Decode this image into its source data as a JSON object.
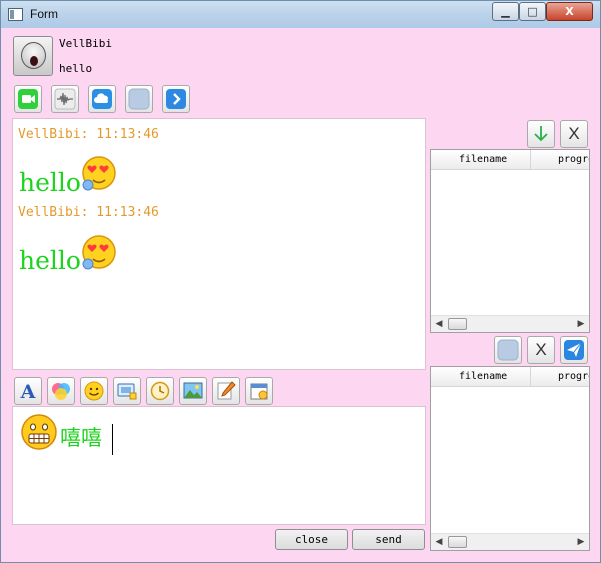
{
  "window": {
    "title": "Form",
    "controls": {
      "minimize": "▁",
      "maximize": "□",
      "close": "X"
    }
  },
  "header": {
    "username": "VellBibi",
    "signature": "hello",
    "toolbar_icons": [
      "video-call-icon",
      "audio-wave-icon",
      "cloud-icon",
      "blank-icon",
      "arrow-right-icon"
    ]
  },
  "messages": [
    {
      "sender": "VellBibi",
      "time": "11:13:46",
      "header_text": "VellBibi:  11:13:46",
      "text": "hello",
      "emoji": "heart-eyes-emoji"
    },
    {
      "sender": "VellBibi",
      "time": "11:13:46",
      "header_text": "VellBibi:  11:13:46",
      "text": "hello",
      "emoji": "heart-eyes-emoji"
    }
  ],
  "input_toolbar": {
    "icons": [
      "font-icon",
      "color-icon",
      "smiley-icon",
      "screenshot-icon",
      "clock-icon",
      "picture-icon",
      "pencil-icon",
      "calendar-icon"
    ]
  },
  "input": {
    "emoji": "grimace-emoji",
    "text": "嘻嘻"
  },
  "buttons": {
    "close": "close",
    "send": "send"
  },
  "receive_panel": {
    "columns": [
      "filename",
      "progress"
    ],
    "accept_icon": "↓",
    "reject_label": "X"
  },
  "send_panel": {
    "columns": [
      "filename",
      "progress"
    ],
    "cancel_label": "X"
  },
  "colors": {
    "background": "#fdd7f2",
    "message_header": "#e39a2d",
    "message_text": "#1ed31e"
  }
}
